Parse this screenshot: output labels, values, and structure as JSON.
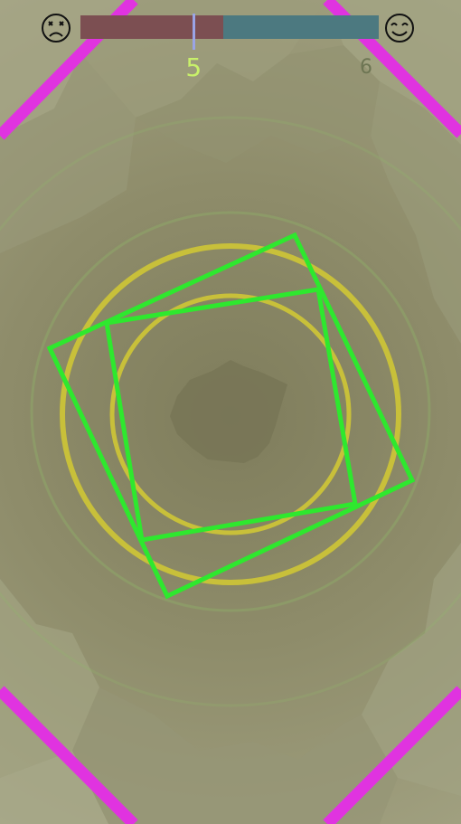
{
  "hud": {
    "left_icon": "sad-face-icon",
    "right_icon": "happy-face-icon",
    "progress": 0.48,
    "current_level": "5",
    "next_level": "6"
  },
  "colors": {
    "background": "#8c8a68",
    "progress_left": "#7c4f52",
    "progress_right": "#4c7980",
    "marker": "#9aa4e6",
    "current_level_text": "#c8f06a",
    "next_level_text": "#6d7553",
    "corner_lines": "#e033e0",
    "target_rings": "#c8c03a",
    "player_squares": "#2ee82e"
  }
}
